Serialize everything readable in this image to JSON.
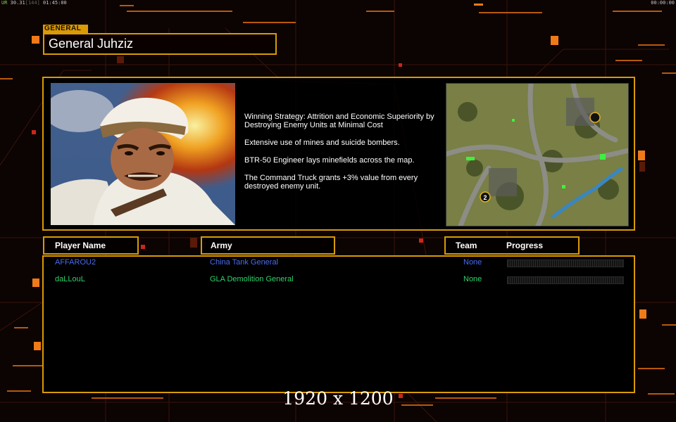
{
  "hud": {
    "left_prefix": "UR",
    "left_mid": "30.31",
    "left_bracket": "[144]",
    "left_time": "01:45:00",
    "right_time": "00:00:00"
  },
  "general": {
    "tag_label": "GENERAL",
    "name": "General Juhziz",
    "portrait_icon": "general-portrait",
    "map_icon": "minimap",
    "description": [
      "Winning Strategy: Attrition and Economic Superiority by\n Destroying Enemy Units at Minimal Cost",
      "Extensive use of mines and suicide bombers.",
      "BTR-50 Engineer lays minefields across the map.",
      "The Command Truck grants +3% value from every\n destroyed enemy unit."
    ],
    "map_marker": "2"
  },
  "table": {
    "headers": {
      "player": "Player Name",
      "army": "Army",
      "team": "Team",
      "progress": "Progress"
    },
    "rows": [
      {
        "name": "AFFAROU2",
        "army": "China Tank General",
        "team": "None",
        "progress": 0,
        "color": "#4a6cf0"
      },
      {
        "name": "daLLouL",
        "army": "GLA Demolition General",
        "team": "None",
        "progress": 0,
        "color": "#2fd46a"
      }
    ]
  },
  "watermark": "1920 x 1200",
  "colors": {
    "accent": "#d99a06",
    "background": "#0c0303",
    "blue_player": "#4a6cf0",
    "green_player": "#2fd46a"
  }
}
